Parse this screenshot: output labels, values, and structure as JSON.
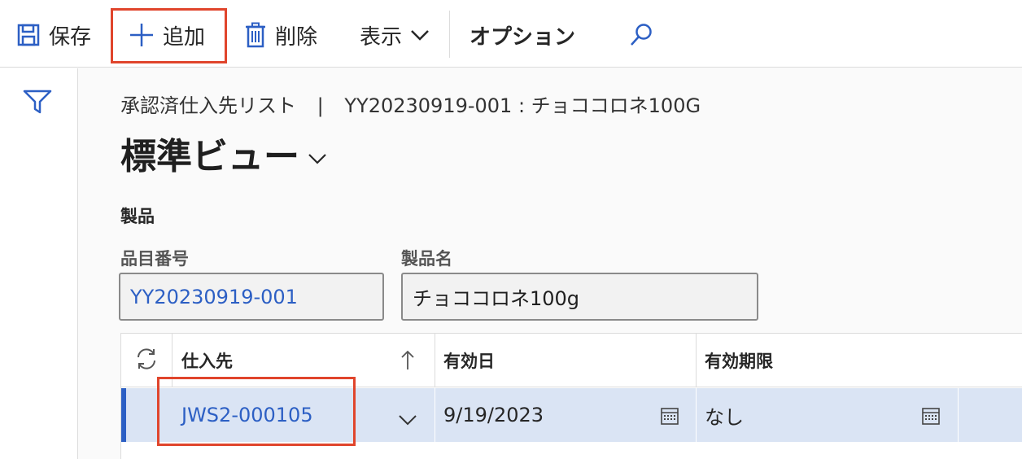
{
  "toolbar": {
    "save_label": "保存",
    "add_label": "追加",
    "delete_label": "削除",
    "view_label": "表示",
    "options_label": "オプション"
  },
  "breadcrumb": {
    "list_name": "承認済仕入先リスト",
    "separator": "|",
    "item": "YY20230919-001 : チョココロネ100G"
  },
  "page": {
    "title": "標準ビュー"
  },
  "product_section": {
    "label": "製品",
    "item_number_label": "品目番号",
    "item_number_value": "YY20230919-001",
    "product_name_label": "製品名",
    "product_name_value": "チョココロネ100g"
  },
  "grid": {
    "headers": {
      "vendor": "仕入先",
      "effective_date": "有効日",
      "expiration": "有効期限"
    },
    "rows": [
      {
        "vendor": "JWS2-000105",
        "effective_date": "9/19/2023",
        "expiration": "なし"
      }
    ]
  },
  "colors": {
    "accent": "#2c5fc4",
    "highlight_box": "#e0452c",
    "selected_row": "#dae4f4"
  },
  "icons": [
    "save-icon",
    "plus-icon",
    "trash-icon",
    "chevron-down-icon",
    "search-icon",
    "filter-icon",
    "refresh-icon",
    "sort-ascending-icon",
    "calendar-icon"
  ]
}
